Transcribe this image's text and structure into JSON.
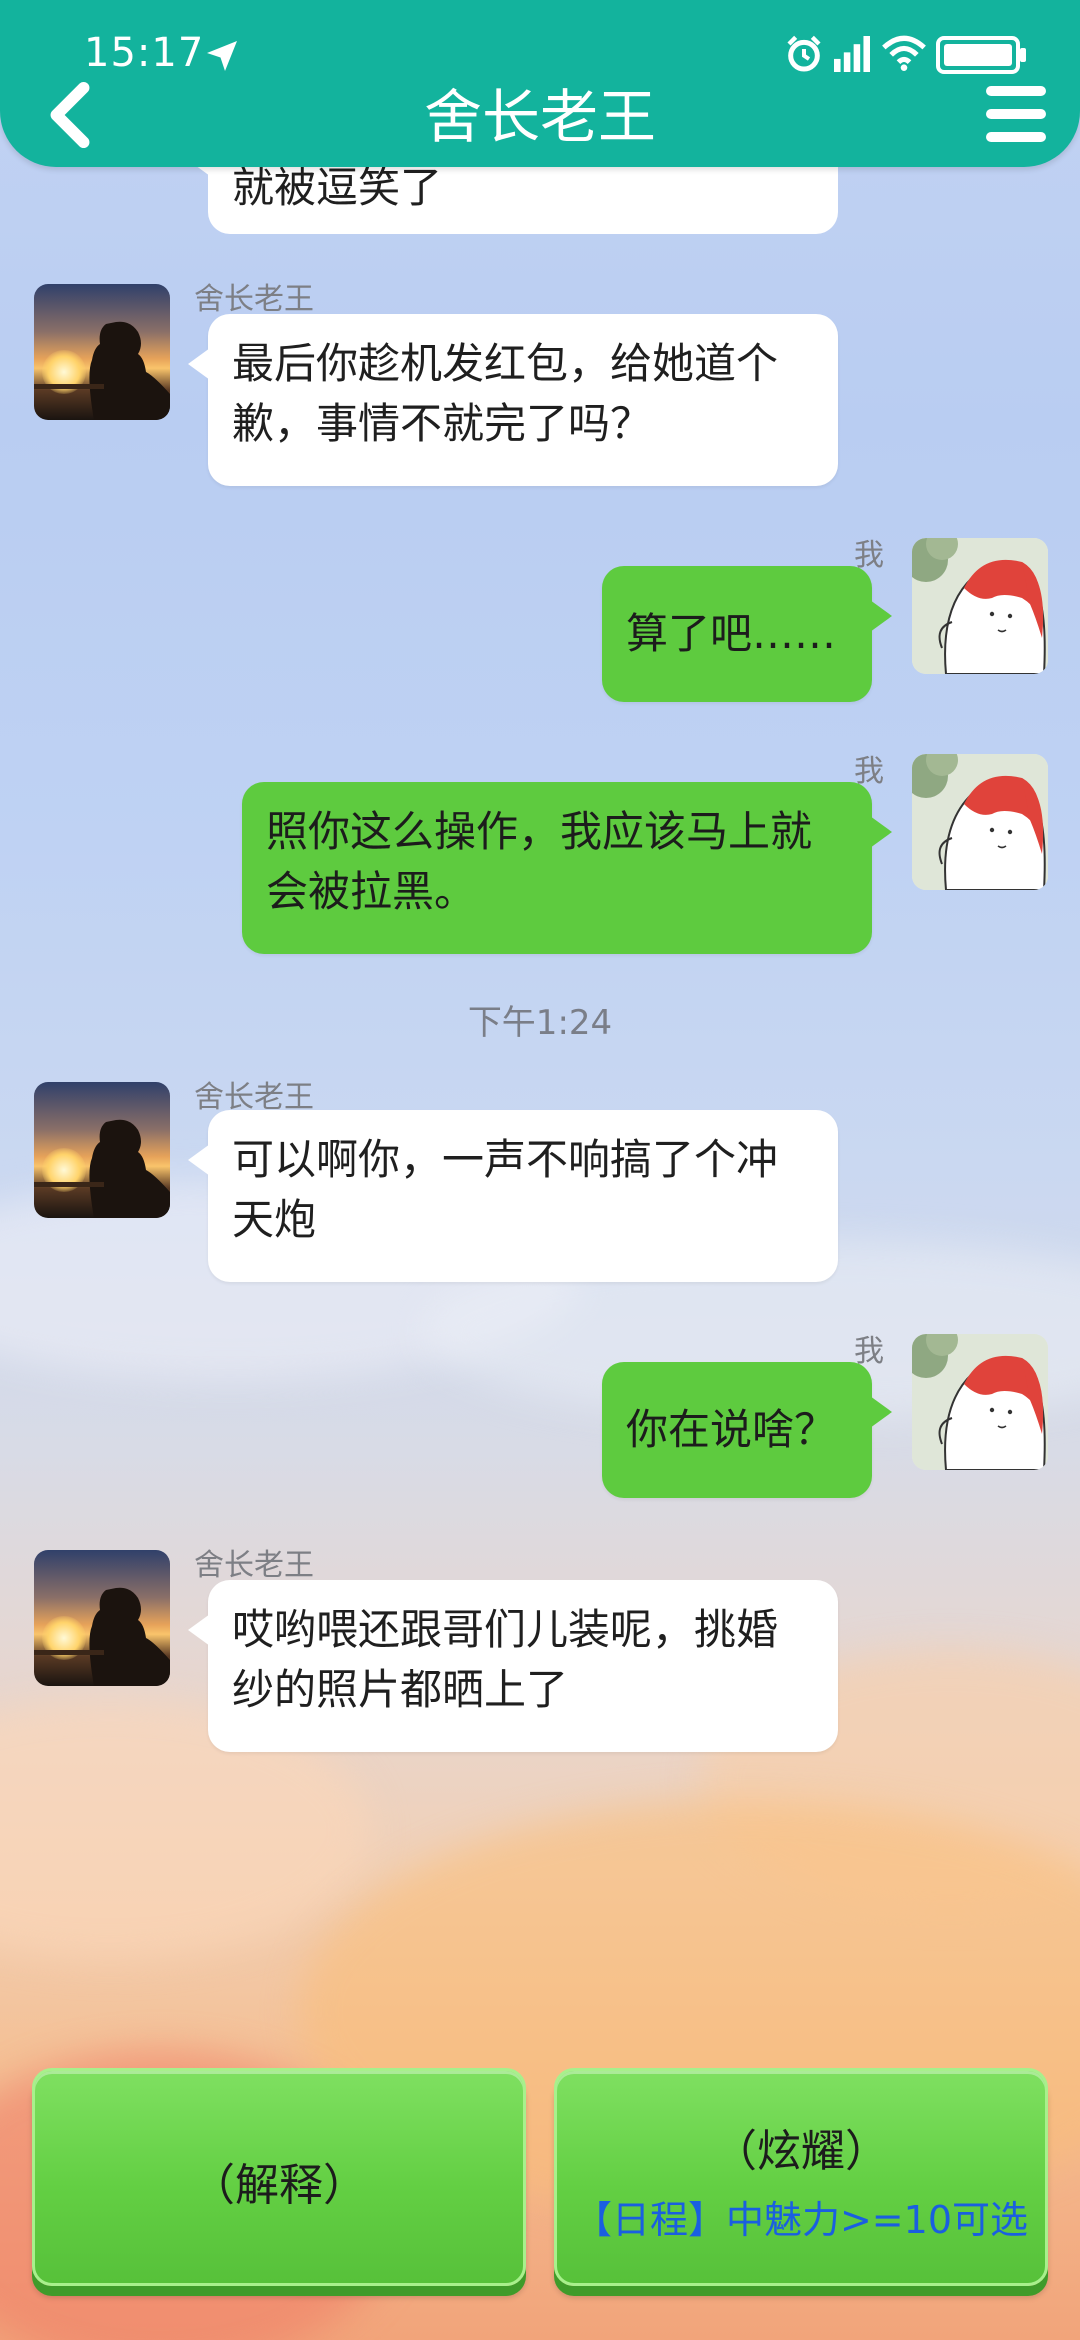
{
  "status_bar": {
    "time": "15:17"
  },
  "header": {
    "title": "舍长老王"
  },
  "messages": [
    {
      "text_line1": "就被逗笑了"
    },
    {
      "sender": "舍长老王",
      "text_line1": "最后你趁机发红包，给她道个",
      "text_line2": "歉，事情不就完了吗？"
    },
    {
      "sender": "我",
      "text_line1": "算了吧……"
    },
    {
      "sender": "我",
      "text_line1": "照你这么操作，我应该马上就",
      "text_line2": "会被拉黑。"
    },
    {
      "sender": "舍长老王",
      "text_line1": "可以啊你，一声不响搞了个冲",
      "text_line2": "天炮"
    },
    {
      "sender": "我",
      "text_line1": "你在说啥？"
    },
    {
      "sender": "舍长老王",
      "text_line1": "哎哟喂还跟哥们儿装呢，挑婚",
      "text_line2": "纱的照片都晒上了"
    }
  ],
  "timestamp": "下午1:24",
  "choices": [
    {
      "label": "（解释）"
    },
    {
      "label": "（炫耀）",
      "condition": "【日程】中魅力>=10可选"
    }
  ],
  "colors": {
    "header": "#13b39d",
    "bubble_right": "#5ecb3f",
    "bubble_left": "#ffffff",
    "choice_button": "#63cf43",
    "condition_text": "#1a5fe0"
  }
}
